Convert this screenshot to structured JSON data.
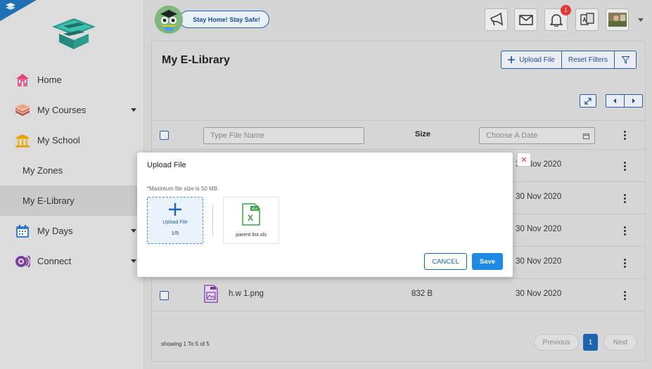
{
  "sidebar": {
    "items": [
      {
        "label": "Home",
        "icon": "home-icon"
      },
      {
        "label": "My Courses",
        "icon": "books-icon"
      },
      {
        "label": "My School",
        "icon": "school-icon"
      },
      {
        "label": "My Zones"
      },
      {
        "label": "My E-Library"
      },
      {
        "label": "My Days",
        "icon": "calendar-icon"
      },
      {
        "label": "Connect",
        "icon": "connect-icon"
      }
    ]
  },
  "topbar": {
    "slogan": "Stay Home! Stay Safe!",
    "notification_count": "1"
  },
  "page": {
    "title": "My E-Library",
    "upload_label": "Upload File",
    "reset_label": "Reset Filters"
  },
  "table": {
    "name_placeholder": "Type File Name",
    "size_header": "Size",
    "date_placeholder": "Choose A Date",
    "rows": [
      {
        "date": "30 Nov 2020"
      },
      {
        "date": "30 Nov 2020"
      },
      {
        "date": "30 Nov 2020"
      },
      {
        "date": "30 Nov 2020"
      },
      {
        "name": "h.w 1.png",
        "size": "832 B",
        "date": "30 Nov 2020"
      }
    ]
  },
  "footer": {
    "showing": "showing 1 To 5 of 5",
    "previous": "Previous",
    "page": "1",
    "next": "Next"
  },
  "modal": {
    "title": "Upload File",
    "note": "*Maximum file size is 50 MB",
    "upload_label": "Upload File",
    "upload_count": "1/5",
    "file_name": "parent list.xls",
    "file_ext": "xlsx",
    "cancel": "CANCEL",
    "save": "Save"
  },
  "colors": {
    "accent": "#1e63b0",
    "save": "#1e88e5",
    "badge": "#e53935"
  }
}
